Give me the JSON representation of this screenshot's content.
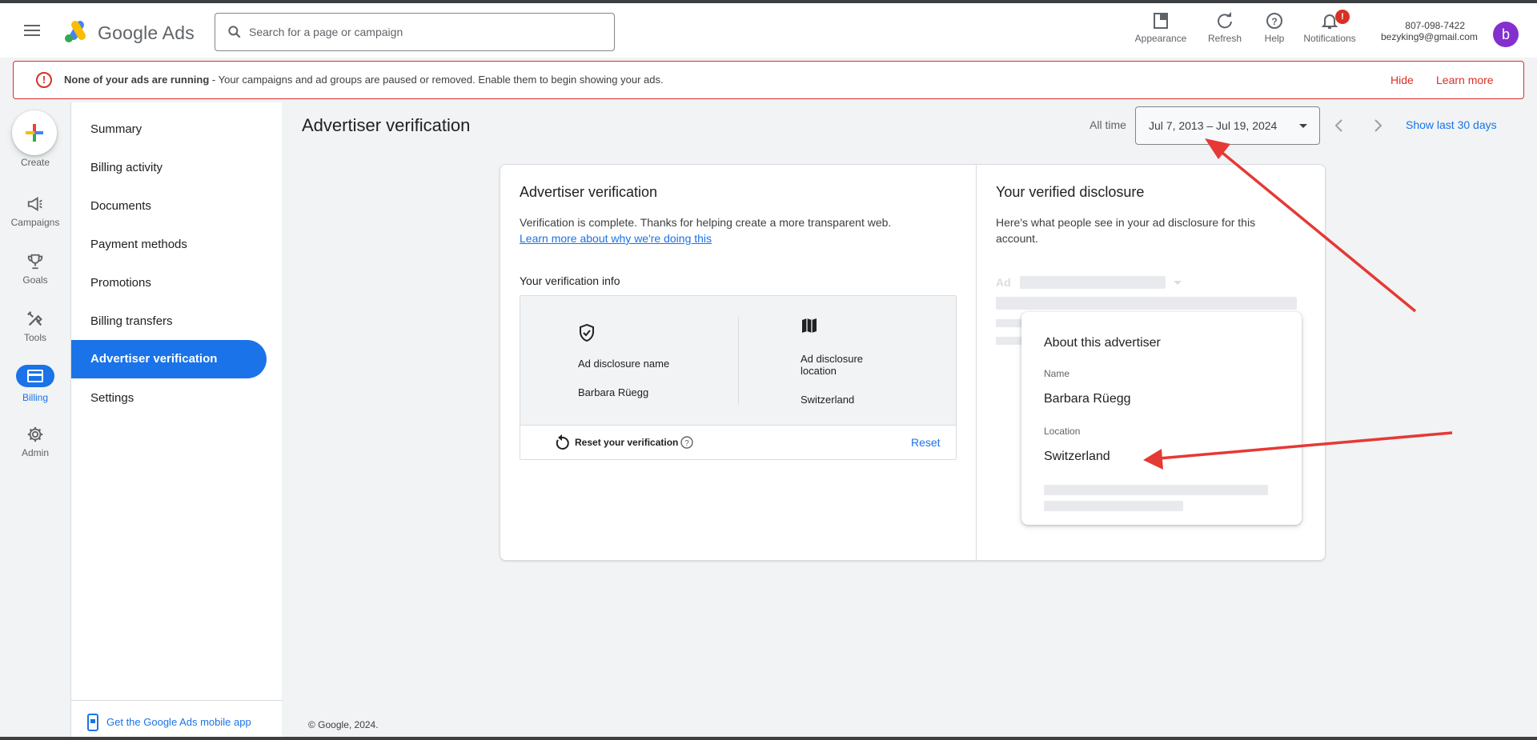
{
  "header": {
    "brand_text": "Google Ads",
    "search_placeholder": "Search for a page or campaign",
    "actions": [
      {
        "label": "Appearance",
        "icon": "appearance-icon"
      },
      {
        "label": "Refresh",
        "icon": "refresh-icon"
      },
      {
        "label": "Help",
        "icon": "help-icon"
      },
      {
        "label": "Notifications",
        "icon": "bell-icon",
        "badge": "!"
      }
    ],
    "account_phone": "807-098-7422",
    "account_email": "bezyking9@gmail.com",
    "avatar_letter": "b"
  },
  "alert": {
    "bold": "None of your ads are running",
    "text": " - Your campaigns and ad groups are paused or removed. Enable them to begin showing your ads.",
    "hide_label": "Hide",
    "learn_label": "Learn more",
    "color": "#d93025"
  },
  "rail": {
    "create_label": "Create",
    "items": [
      {
        "label": "Campaigns",
        "icon": "megaphone-icon"
      },
      {
        "label": "Goals",
        "icon": "trophy-icon"
      },
      {
        "label": "Tools",
        "icon": "tools-icon"
      },
      {
        "label": "Billing",
        "icon": "billing-card-icon",
        "active": true
      },
      {
        "label": "Admin",
        "icon": "gear-icon"
      }
    ]
  },
  "subnav": {
    "items": [
      {
        "label": "Summary"
      },
      {
        "label": "Billing activity"
      },
      {
        "label": "Documents"
      },
      {
        "label": "Payment methods"
      },
      {
        "label": "Promotions"
      },
      {
        "label": "Billing transfers"
      },
      {
        "label": "Advertiser verification",
        "active": true
      },
      {
        "label": "Settings"
      }
    ],
    "mobile_app_label": "Get the Google Ads mobile app"
  },
  "page": {
    "title": "Advertiser verification",
    "all_time_label": "All time",
    "date_range": "Jul 7, 2013 – Jul 19, 2024",
    "show_last_label": "Show last 30 days"
  },
  "verification": {
    "title": "Advertiser verification",
    "description": "Verification is complete. Thanks for helping create a more transparent web.",
    "learn_link": "Learn more about why we're doing this",
    "info_title": "Your verification info",
    "name_label": "Ad disclosure name",
    "name_value": "Barbara Rüegg",
    "location_label_1": "Ad disclosure",
    "location_label_2": "location",
    "location_value": "Switzerland",
    "reset_label": "Reset your verification",
    "reset_button": "Reset"
  },
  "disclosure": {
    "title": "Your verified disclosure",
    "description_1": "Here's what people see in your ad disclosure for this",
    "description_2": "account.",
    "ad_label": "Ad",
    "popup_title": "About this advertiser",
    "name_label": "Name",
    "name_value": "Barbara Rüegg",
    "location_label": "Location",
    "location_value": "Switzerland"
  },
  "footer": {
    "copyright": "© Google, 2024."
  },
  "colors": {
    "accent": "#1a73e8",
    "error": "#d93025",
    "annotation_arrow": "#e53935",
    "avatar": "#8430ce"
  }
}
